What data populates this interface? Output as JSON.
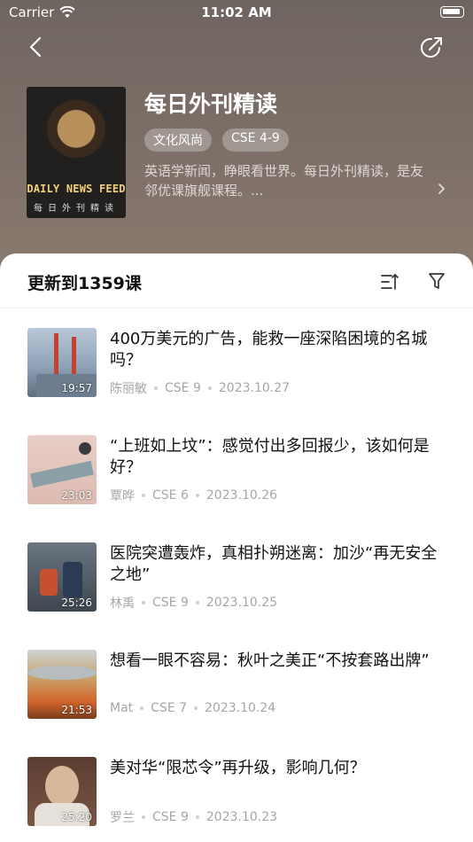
{
  "status": {
    "carrier": "Carrier",
    "time": "11:02 AM"
  },
  "course": {
    "title": "每日外刊精读",
    "tags": [
      "文化风尚",
      "CSE 4-9"
    ],
    "description": "英语学新闻，睁眼看世界。每日外刊精读，是友邻优课旗舰课程。...",
    "cover_title": "DAILY NEWS FEED",
    "cover_subtitle": "每日外刊精读"
  },
  "list_header": {
    "title": "更新到1359课"
  },
  "lessons": [
    {
      "title": "400万美元的广告，能救一座深陷困境的名城吗？",
      "duration": "19:57",
      "author": "陈丽敏",
      "level": "CSE 9",
      "date": "2023.10.27",
      "thumb_colors": [
        "#a7b7c9",
        "#c2422f"
      ]
    },
    {
      "title": "“上班如上坟”：感觉付出多回报少，该如何是好？",
      "duration": "23:03",
      "author": "覃晔",
      "level": "CSE 6",
      "date": "2023.10.26",
      "thumb_colors": [
        "#e5c7bf",
        "#8aa0a6"
      ]
    },
    {
      "title": "医院突遭轰炸，真相扑朔迷离：加沙“再无安全之地”",
      "duration": "25:26",
      "author": "林禹",
      "level": "CSE 9",
      "date": "2023.10.25",
      "thumb_colors": [
        "#4f5b66",
        "#c7502f"
      ]
    },
    {
      "title": "想看一眼不容易：秋叶之美正“不按套路出牌”",
      "duration": "21:53",
      "author": "Mat",
      "level": "CSE 7",
      "date": "2023.10.24",
      "thumb_colors": [
        "#c9a36c",
        "#d2652b"
      ]
    },
    {
      "title": "美对华“限芯令”再升级，影响几何？",
      "duration": "25:20",
      "author": "罗兰",
      "level": "CSE 9",
      "date": "2023.10.23",
      "thumb_colors": [
        "#6b4a3a",
        "#d9b79b"
      ]
    }
  ]
}
